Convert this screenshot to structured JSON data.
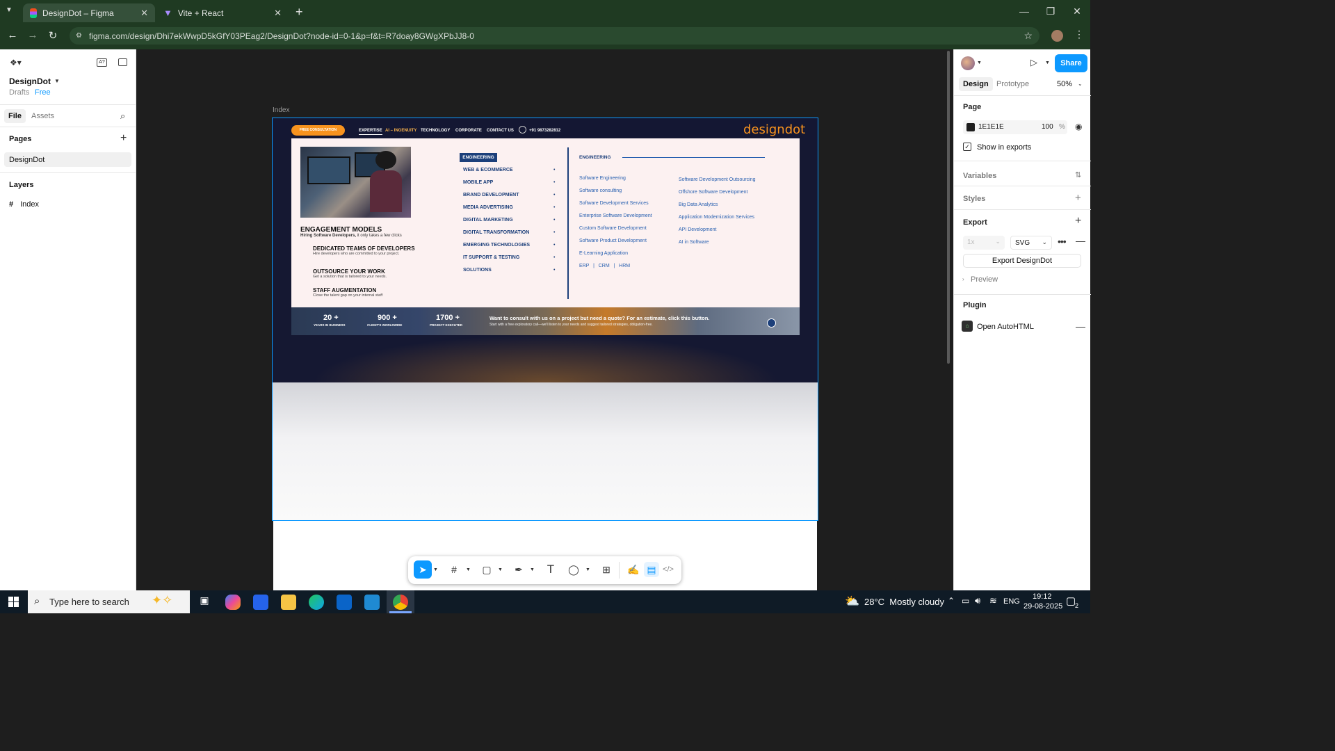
{
  "browser": {
    "tabs": [
      {
        "title": "DesignDot – Figma",
        "active": true
      },
      {
        "title": "Vite + React",
        "active": false
      }
    ],
    "url": "figma.com/design/Dhi7ekWwpD5kGfY03PEag2/DesignDot?node-id=0-1&p=f&t=R7doay8GWgXPbJJ8-0"
  },
  "figma": {
    "file_name": "DesignDot",
    "drafts_label": "Drafts",
    "plan_label": "Free",
    "left_tabs": [
      "File",
      "Assets"
    ],
    "pages_heading": "Pages",
    "pages": [
      "DesignDot"
    ],
    "layers_heading": "Layers",
    "layers": [
      "Index"
    ],
    "frame_label": "Index",
    "right": {
      "share_label": "Share",
      "tabs": [
        "Design",
        "Prototype"
      ],
      "zoom": "50%",
      "page_heading": "Page",
      "page_color_hex": "1E1E1E",
      "page_opacity": "100",
      "opacity_unit": "%",
      "show_in_exports": "Show in exports",
      "variables_heading": "Variables",
      "styles_heading": "Styles",
      "export_heading": "Export",
      "export_scale": "1x",
      "export_format": "SVG",
      "export_button": "Export DesignDot",
      "preview_label": "Preview",
      "plugin_heading": "Plugin",
      "plugin_name": "Open AutoHTML"
    }
  },
  "design": {
    "cta": "FREE CONSULTATION",
    "nav": [
      "EXPERTISE",
      "AI – INGENUITY",
      "TECHNOLOGY",
      "CORPORATE",
      "CONTACT US"
    ],
    "phone": "+91 9873282812",
    "logo": "designdot",
    "engagement_title": "ENGAGEMENT MODELS",
    "engagement_sub_bold": "Hiring Software Developers,",
    "engagement_sub": " it only takes a few clicks",
    "models": [
      {
        "title": "DEDICATED TEAMS OF DEVELOPERS",
        "desc": "Hire developers who are committed to your project."
      },
      {
        "title": "OUTSOURCE YOUR WORK",
        "desc": "Get a solution that is tailored to your needs."
      },
      {
        "title": "STAFF AUGMENTATION",
        "desc": "Close the talent gap on your internal staff"
      }
    ],
    "menu_active": "ENGINEERING",
    "menu": [
      "WEB & ECOMMERCE",
      "MOBILE  APP",
      "BRAND DEVELOPMENT",
      "MEDIA ADVERTISING",
      "DIGITAL MARKETING",
      "DIGITAL TRANSFORMATION",
      "EMERGING TECHNOLOGIES",
      "IT SUPPORT & TESTING",
      "SOLUTIONS"
    ],
    "menu_dot": "•",
    "sub_heading": "ENGINEERING",
    "sub_col1": [
      "Software Engineering",
      "Software consulting",
      "Software Development Services",
      "Enterprise Software Development",
      "Custom Software Development",
      "Software Product Development",
      "E-Learning Application"
    ],
    "sub_links": "ERP   |   CRM   |   HRM",
    "sub_col2": [
      "Software Development Outsourcing",
      "Offshore Software Development",
      "Big Data Analytics",
      "Application Modernization Services",
      "API Development",
      "AI in Software"
    ],
    "stats": [
      {
        "value": "20 +",
        "label": "YEARS IN BUSINESS"
      },
      {
        "value": "900 +",
        "label": "CLIENT'S WORLDWIDE"
      },
      {
        "value": "1700 +",
        "label": "PROJECT EXECUTED"
      }
    ],
    "quote_title": "Want to consult with us on a project but need a quote? For an estimate, click this button.",
    "quote_sub": "Start with a free exploratory call—we'll listen to your needs and suggest tailored strategies, obligation-free."
  },
  "taskbar": {
    "search_placeholder": "Type here to search",
    "weather": "28°C  Mostly cloudy",
    "lang": "ENG",
    "time": "19:12",
    "date": "29-08-2025",
    "notif_count": "2"
  },
  "colors": {
    "accent_blue": "#0d99ff",
    "chrome_bg": "#1f3a22",
    "cta_orange": "#f7931e",
    "navy": "#1c3f7a"
  }
}
